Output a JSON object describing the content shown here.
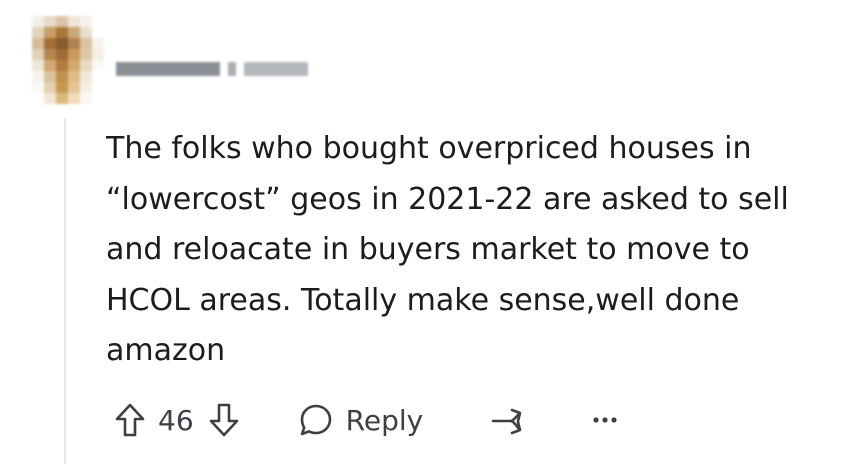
{
  "comment": {
    "body": "The folks who bought overpriced houses in “lowercost” geos in 2021-22 are asked to sell and reloacate in buyers market to move to HCOL areas. Totally make sense,well done amazon"
  },
  "actions": {
    "vote_count": "46",
    "reply_label": "Reply"
  },
  "icons": {
    "upvote": "upvote-arrow-icon",
    "downvote": "downvote-arrow-icon",
    "reply": "speech-bubble-icon",
    "share": "share-arrow-icon",
    "more": "more-dots-icon"
  },
  "colors": {
    "text": "#1c1c1c",
    "action": "#3c3f44",
    "thread_line": "#e5e7ea"
  }
}
